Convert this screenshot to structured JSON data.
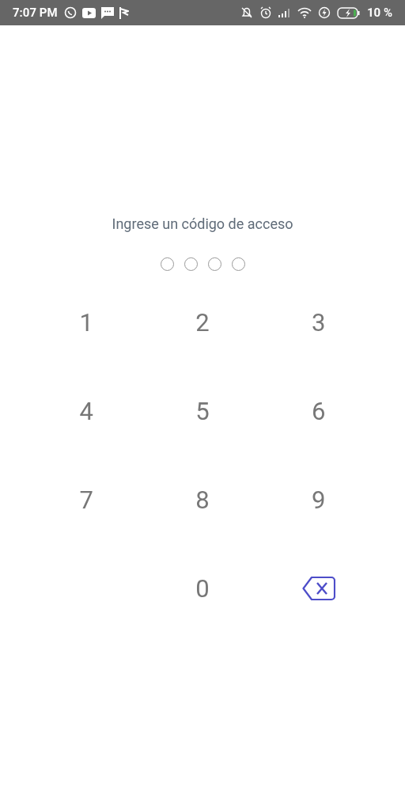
{
  "status_bar": {
    "time": "7:07 PM",
    "battery": "10 %"
  },
  "prompt": "Ingrese un código de acceso",
  "pin_dots": [
    {
      "filled": false
    },
    {
      "filled": false
    },
    {
      "filled": false
    },
    {
      "filled": false
    }
  ],
  "keypad": [
    {
      "kind": "digit",
      "label": "1"
    },
    {
      "kind": "digit",
      "label": "2"
    },
    {
      "kind": "digit",
      "label": "3"
    },
    {
      "kind": "digit",
      "label": "4"
    },
    {
      "kind": "digit",
      "label": "5"
    },
    {
      "kind": "digit",
      "label": "6"
    },
    {
      "kind": "digit",
      "label": "7"
    },
    {
      "kind": "digit",
      "label": "8"
    },
    {
      "kind": "digit",
      "label": "9"
    },
    {
      "kind": "empty"
    },
    {
      "kind": "digit",
      "label": "0"
    },
    {
      "kind": "backspace"
    }
  ]
}
